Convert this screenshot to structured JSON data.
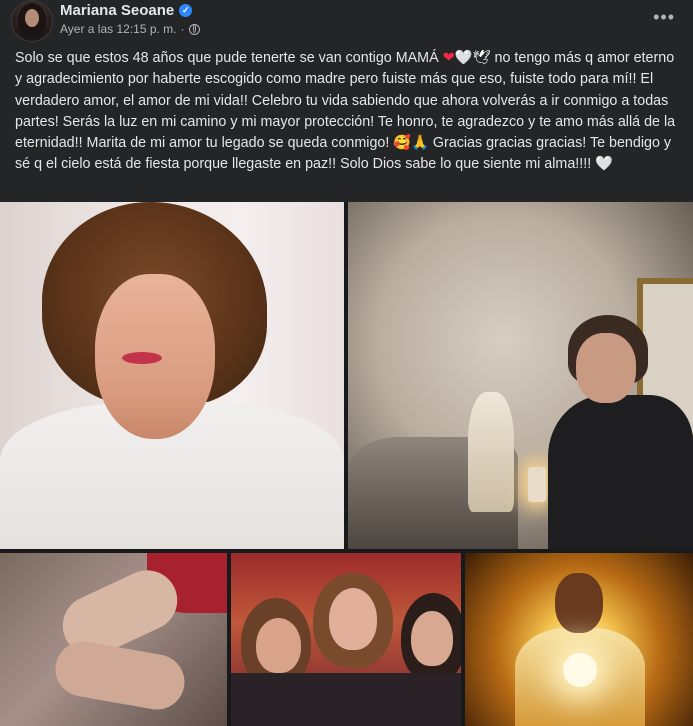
{
  "post": {
    "author": "Mariana Seoane",
    "verified_badge": "✓",
    "timestamp": "Ayer a las 12:15 p. m.",
    "separator": "·",
    "privacy_icon": "globe-icon",
    "more_label": "•••",
    "text_segments": [
      "Solo se que estos 48 años que pude tenerte se van contigo MAMÁ ",
      "❤",
      "🤍",
      "🕊",
      " no tengo más q amor eterno y agradecimiento por haberte escogido como madre pero fuiste más que eso, fuiste todo para mí!! El verdadero amor, el amor de mi vida!! Celebro tu vida sabiendo que ahora volverás a ir conmigo a todas partes! Serás la luz en mi camino y mi mayor protección! Te honro, te agradezco y te amo más allá de la eternidad!! Marita de mi amor tu legado se queda conmigo! ",
      "🥰🙏",
      "  Gracias gracias gracias! Te bendigo y sé q el cielo está de fiesta porque llegaste en paz!!  Solo Dios sabe lo que siente mi alma!!!! ",
      "🤍"
    ]
  },
  "colors": {
    "background": "#242526",
    "text": "#e4e6eb",
    "secondary_text": "#b0b3b8",
    "verified": "#2d88ff"
  },
  "photos": [
    {
      "name": "portrait-photo"
    },
    {
      "name": "vigil-photo"
    },
    {
      "name": "holding-hands-photo"
    },
    {
      "name": "family-photo"
    },
    {
      "name": "jesus-light-photo"
    }
  ]
}
